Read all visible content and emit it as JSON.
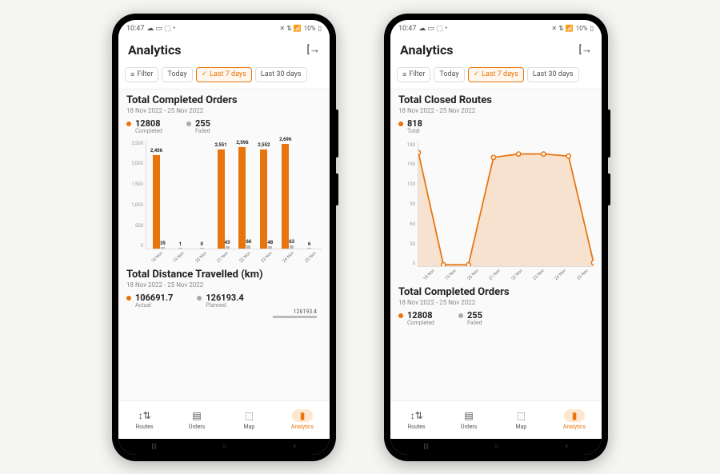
{
  "status": {
    "time": "10:47",
    "battery_text": "10%"
  },
  "header": {
    "title": "Analytics"
  },
  "filters": {
    "filter_label": "Filter",
    "today": "Today",
    "last7": "Last 7 days",
    "last30": "Last 30 days"
  },
  "phone1": {
    "orders_title": "Total Completed Orders",
    "date_range": "18 Nov 2022 - 25 Nov 2022",
    "completed_val": "12808",
    "completed_lab": "Completed",
    "failed_val": "255",
    "failed_lab": "Failed",
    "distance_title": "Total Distance Travelled (km)",
    "actual_val": "106691.7",
    "actual_lab": "Actual",
    "planned_val": "126193.4",
    "planned_lab": "Planned",
    "planned_inline": "126193.4"
  },
  "phone2": {
    "routes_title": "Total Closed Routes",
    "date_range": "18 Nov 2022 - 25 Nov 2022",
    "total_val": "818",
    "total_lab": "Total",
    "orders_title": "Total Completed Orders",
    "completed_val": "12808",
    "completed_lab": "Completed",
    "failed_val": "255",
    "failed_lab": "Failed"
  },
  "nav": {
    "routes": "Routes",
    "orders": "Orders",
    "map": "Map",
    "analytics": "Analytics"
  },
  "chart_data": [
    {
      "type": "bar",
      "title": "Total Completed Orders",
      "date_range": "18 Nov 2022 - 25 Nov 2022",
      "categories": [
        "18 Nov",
        "19 Nov",
        "20 Nov",
        "21 Nov",
        "22 Nov",
        "23 Nov",
        "24 Nov",
        "25 Nov"
      ],
      "series": [
        {
          "name": "Completed",
          "color": "#e8740c",
          "values": [
            2406,
            0,
            0,
            2551,
            2596,
            2552,
            2696,
            0
          ]
        },
        {
          "name": "Failed",
          "color": "#bbbbbb",
          "values": [
            35,
            1,
            0,
            43,
            66,
            48,
            63,
            6
          ]
        }
      ],
      "yticks": [
        0,
        500,
        1000,
        1500,
        2000,
        2500
      ],
      "ylim": [
        0,
        2800
      ]
    },
    {
      "type": "area",
      "title": "Total Closed Routes",
      "date_range": "18 Nov 2022 - 25 Nov 2022",
      "x": [
        "18 Nov",
        "19 Nov",
        "20 Nov",
        "21 Nov",
        "22 Nov",
        "23 Nov",
        "24 Nov",
        "25 Nov"
      ],
      "values": [
        165,
        2,
        2,
        158,
        163,
        163,
        160,
        5
      ],
      "yticks": [
        0,
        30,
        60,
        90,
        120,
        150,
        180
      ],
      "ylim": [
        0,
        180
      ],
      "color": "#e8740c"
    }
  ]
}
